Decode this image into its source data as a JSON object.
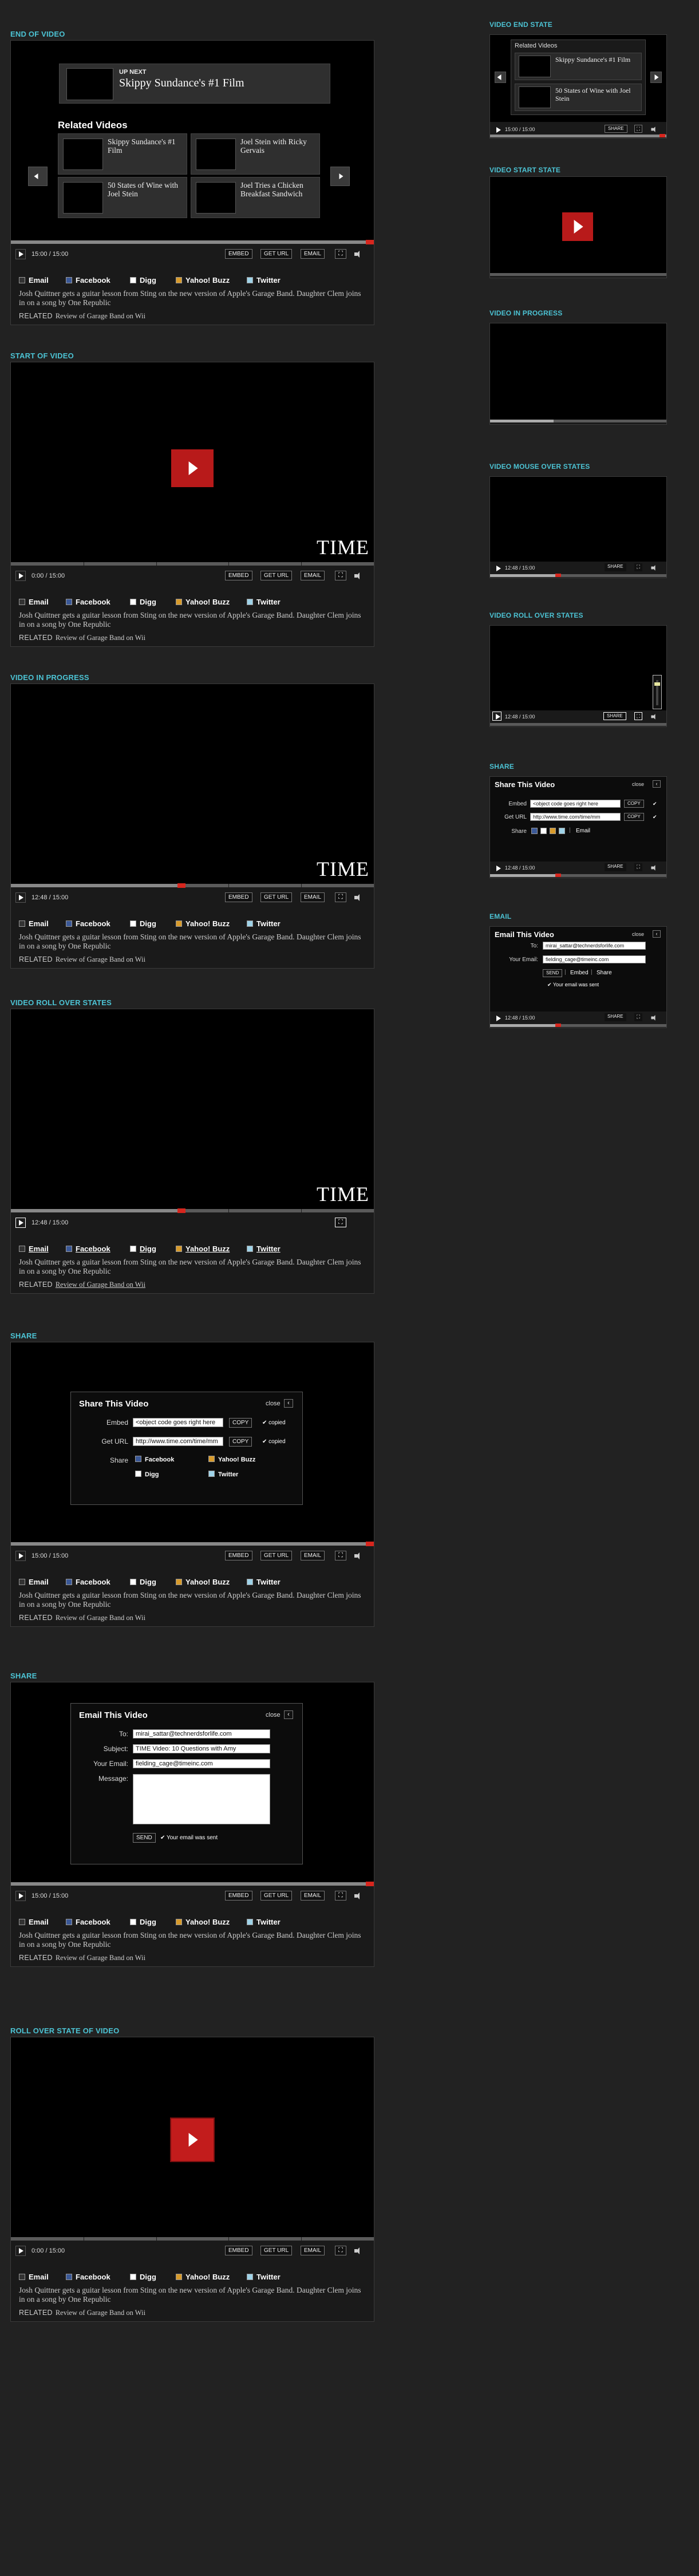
{
  "colors": {
    "accent": "#4cc3d4",
    "red": "#d7261e",
    "bg": "#222222"
  },
  "controls": {
    "embed": "EMBED",
    "get_url": "GET URL",
    "email": "EMAIL",
    "share": "SHARE",
    "fullscreen": "⛶"
  },
  "social": {
    "email": "Email",
    "facebook": "Facebook",
    "digg": "Digg",
    "yahoo": "Yahoo! Buzz",
    "twitter": "Twitter"
  },
  "description": "Josh Quittner gets a guitar lesson from Sting on the new version of Apple's Garage Band. Daughter Clem joins in on a song by One Republic",
  "related": {
    "label": "RELATED",
    "link": "Review of Garage Band on Wii"
  },
  "brand": "TIME",
  "end_of_video": {
    "title": "END OF VIDEO",
    "up_next_label": "UP NEXT",
    "up_next_title": "Skippy Sundance's #1 Film",
    "related_heading": "Related Videos",
    "items": [
      "Skippy Sundance's #1 Film",
      "Joel Stein with Ricky Gervais",
      "50 States of Wine with Joel Stein",
      "Joel Tries a Chicken Breakfast Sandwich"
    ],
    "time": "15:00 / 15:00",
    "progress": 1.0
  },
  "start_of_video": {
    "title": "START OF VIDEO",
    "time": "0:00 / 15:00",
    "progress": 0
  },
  "in_progress": {
    "title": "VIDEO IN PROGRESS",
    "time": "12:48 / 15:00",
    "progress": 0.47
  },
  "rollover": {
    "title": "VIDEO ROLL OVER STATES",
    "time": "12:48 / 15:00",
    "progress": 0.47
  },
  "share": {
    "title": "SHARE",
    "heading": "Share This Video",
    "close": "close",
    "embed_label": "Embed",
    "embed_value": "<object code goes right here",
    "copy": "COPY",
    "copied": "copied",
    "url_label": "Get URL",
    "url_value": "http://www.time.com/time/mm",
    "share_label": "Share",
    "time": "15:00 / 15:00",
    "progress": 1.0
  },
  "email_share": {
    "title": "SHARE",
    "heading": "Email This Video",
    "close": "close",
    "to_label": "To:",
    "to_value": "mirai_sattar@technerdsforlife.com",
    "subject_label": "Subject:",
    "subject_value": "TIME Video: 10 Questions with Amy",
    "your_label": "Your Email:",
    "your_value": "fielding_cage@timeinc.com",
    "message_label": "Message:",
    "send": "SEND",
    "sent": "Your email was sent",
    "time": "15:00 / 15:00",
    "progress": 1.0
  },
  "rollover_start": {
    "title": "ROLL OVER STATE OF VIDEO",
    "time": "0:00 / 15:00",
    "progress": 0
  },
  "small": {
    "end_state": {
      "title": "VIDEO END STATE",
      "related_heading": "Related Videos",
      "items": [
        "Skippy Sundance's #1 Film",
        "50 States of Wine with Joel Stein"
      ],
      "time": "15:00 / 15:00"
    },
    "start_state": {
      "title": "VIDEO START STATE"
    },
    "in_progress": {
      "title": "VIDEO IN PROGRESS"
    },
    "mouse_over": {
      "title": "VIDEO MOUSE OVER STATES",
      "time": "12:48 / 15:00"
    },
    "roll_over": {
      "title": "VIDEO ROLL OVER STATES",
      "time": "12:48 / 15:00"
    },
    "share": {
      "title": "SHARE",
      "heading": "Share This Video",
      "close": "close",
      "embed_label": "Embed",
      "embed_value": "<object code goes right here",
      "url_label": "Get URL",
      "url_value": "http://www.time.com/time/mm",
      "share_label": "Share",
      "email_link": "Email",
      "copy": "COPY",
      "time": "12:48 / 15:00"
    },
    "email": {
      "title": "EMAIL",
      "heading": "Email This Video",
      "close": "close",
      "to_label": "To:",
      "to_value": "mirai_sattar@technerdsforlife.com",
      "your_label": "Your Email:",
      "your_value": "fielding_cage@timeinc.com",
      "send": "SEND",
      "embed_link": "Embed",
      "share_link": "Share",
      "sent": "Your email was sent",
      "time": "12:48 / 15:00"
    }
  }
}
